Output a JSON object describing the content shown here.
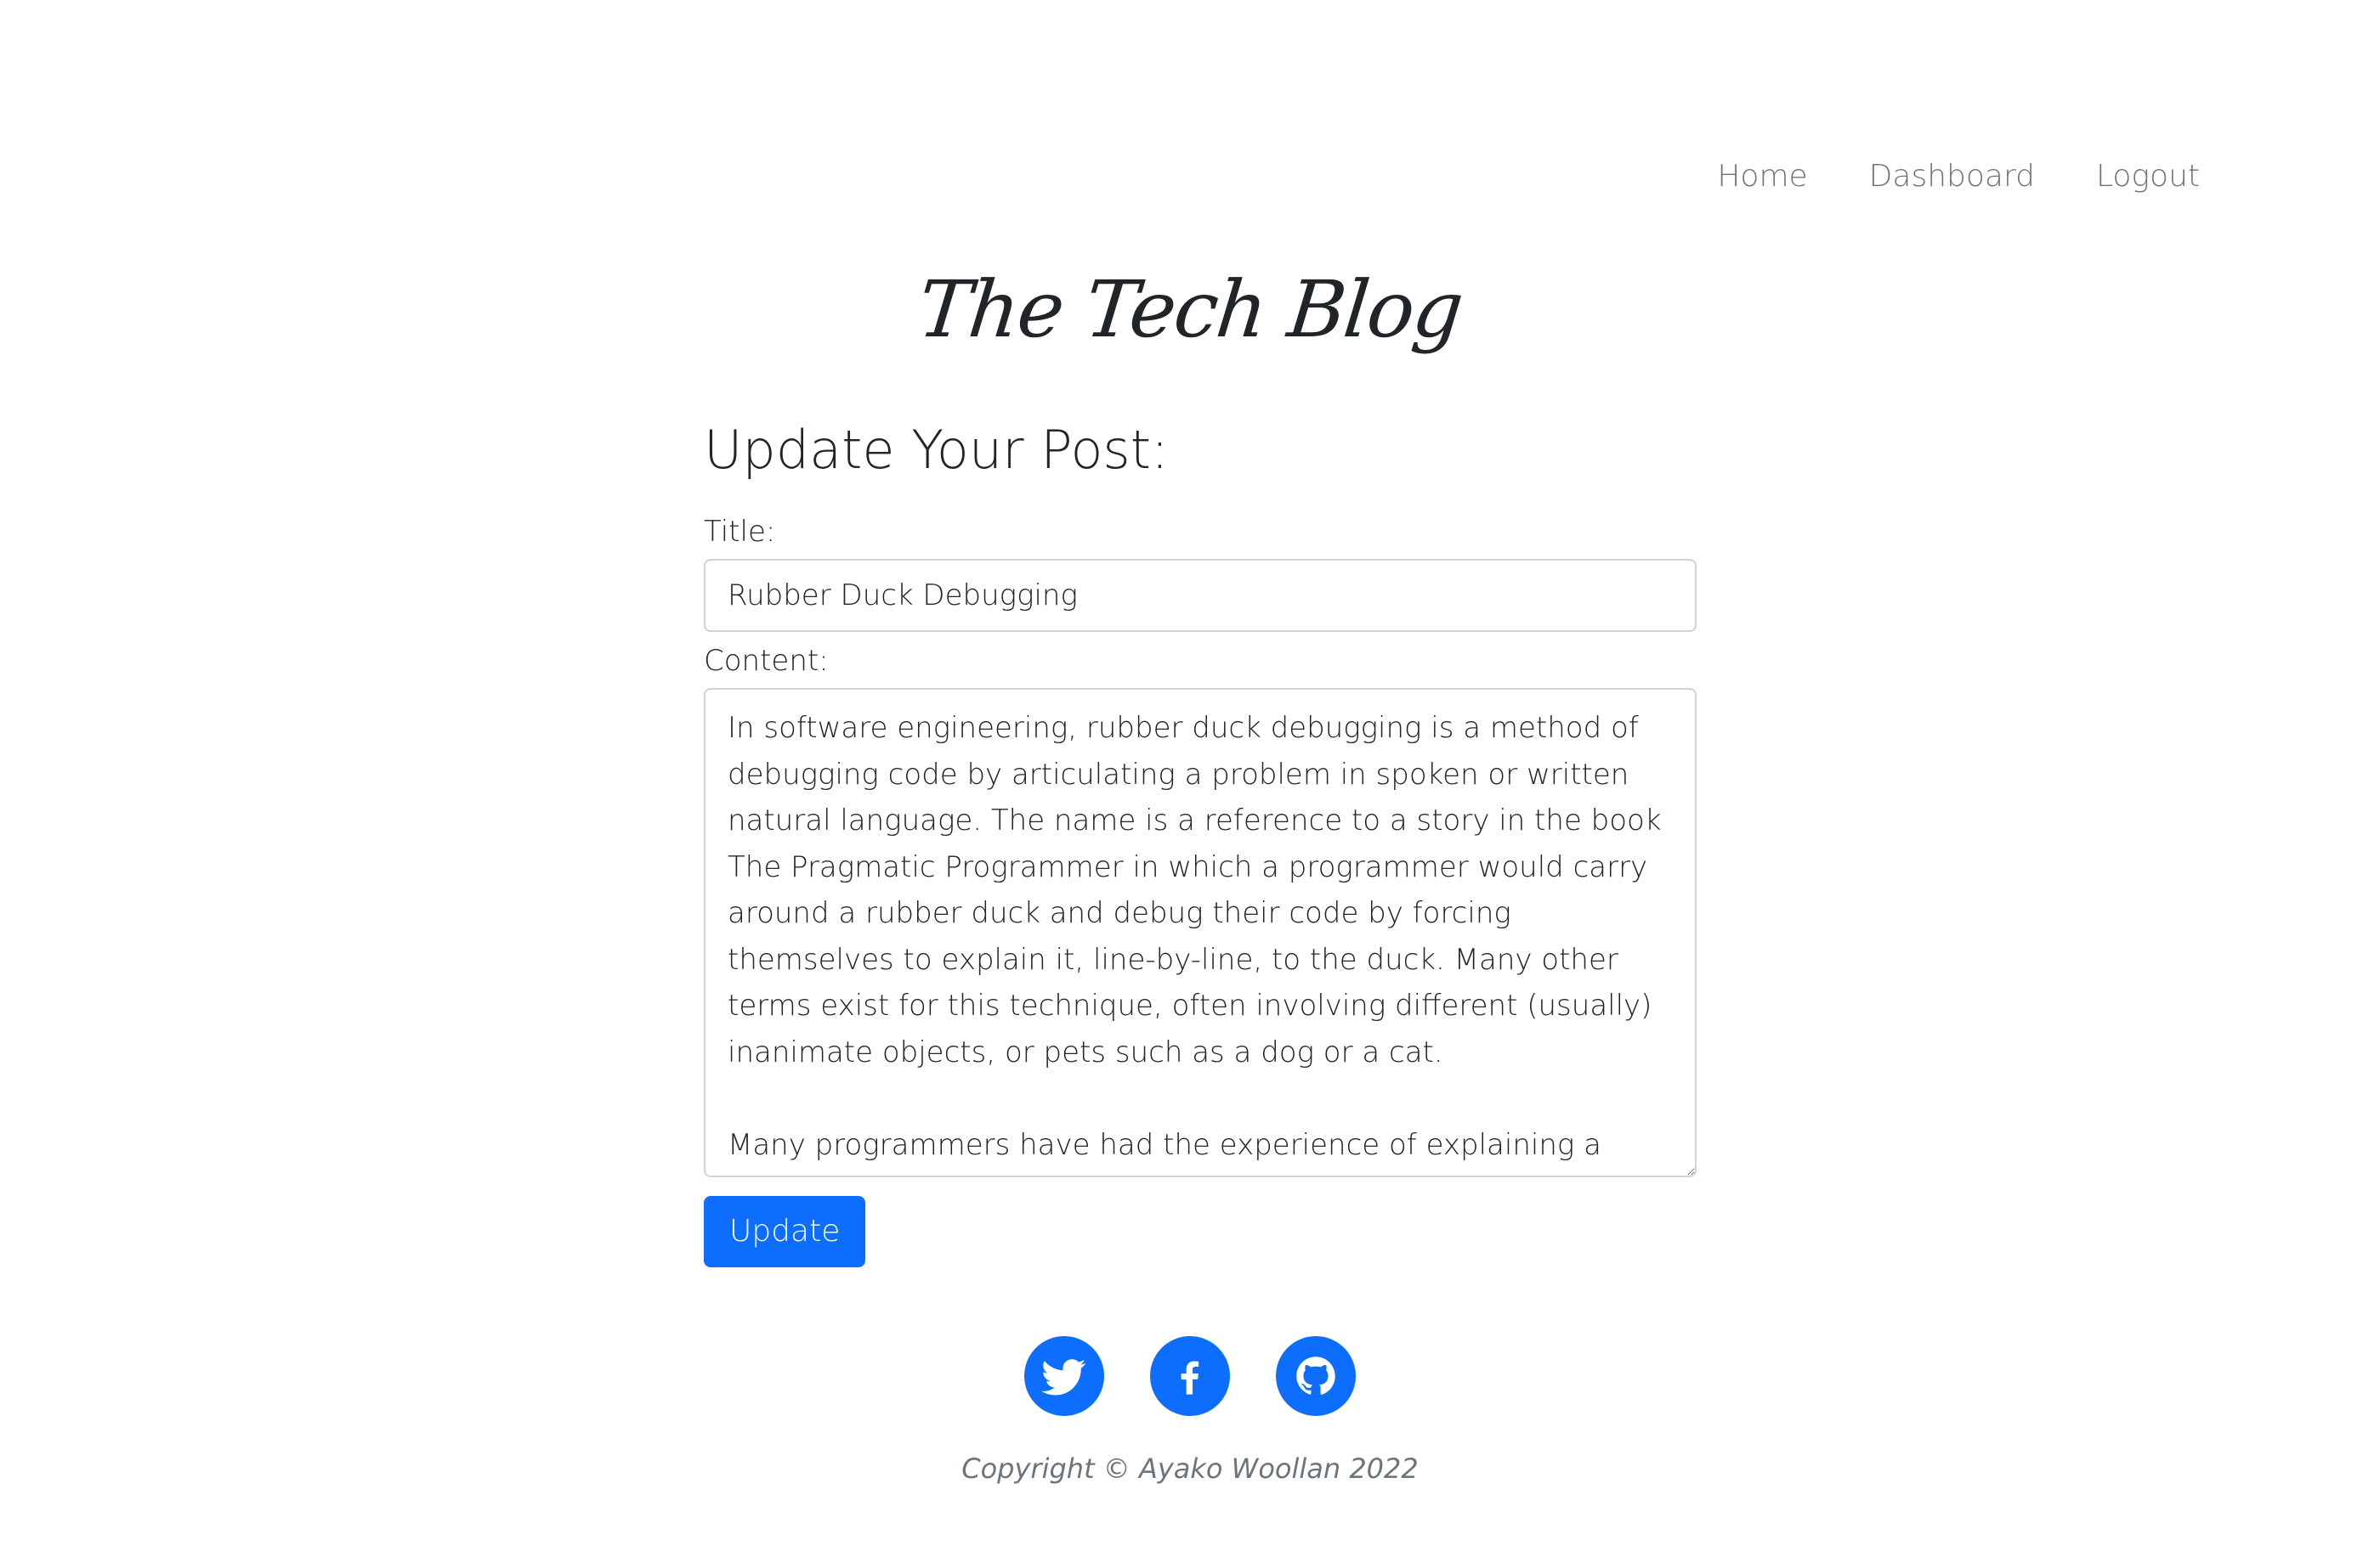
{
  "nav": {
    "items": [
      {
        "label": "Home"
      },
      {
        "label": "Dashboard"
      },
      {
        "label": "Logout"
      }
    ]
  },
  "logo": {
    "text": "The Tech Blog"
  },
  "form": {
    "heading": "Update Your Post:",
    "title_label": "Title:",
    "title_value": "Rubber Duck Debugging",
    "content_label": "Content:",
    "content_value": "In software engineering, rubber duck debugging is a method of debugging code by articulating a problem in spoken or written natural language. The name is a reference to a story in the book The Pragmatic Programmer in which a programmer would carry around a rubber duck and debug their code by forcing themselves to explain it, line-by-line, to the duck. Many other terms exist for this technique, often involving different (usually) inanimate objects, or pets such as a dog or a cat.\n\nMany programmers have had the experience of explaining a problem",
    "submit_label": "Update"
  },
  "footer": {
    "socials": [
      {
        "icon": "twitter-icon"
      },
      {
        "icon": "facebook-icon"
      },
      {
        "icon": "github-icon"
      }
    ],
    "copyright": "Copyright © Ayako Woollan 2022"
  },
  "colors": {
    "accent": "#0d6efd",
    "nav_text": "#6c757d",
    "text": "#212529",
    "border": "#ced4da"
  }
}
